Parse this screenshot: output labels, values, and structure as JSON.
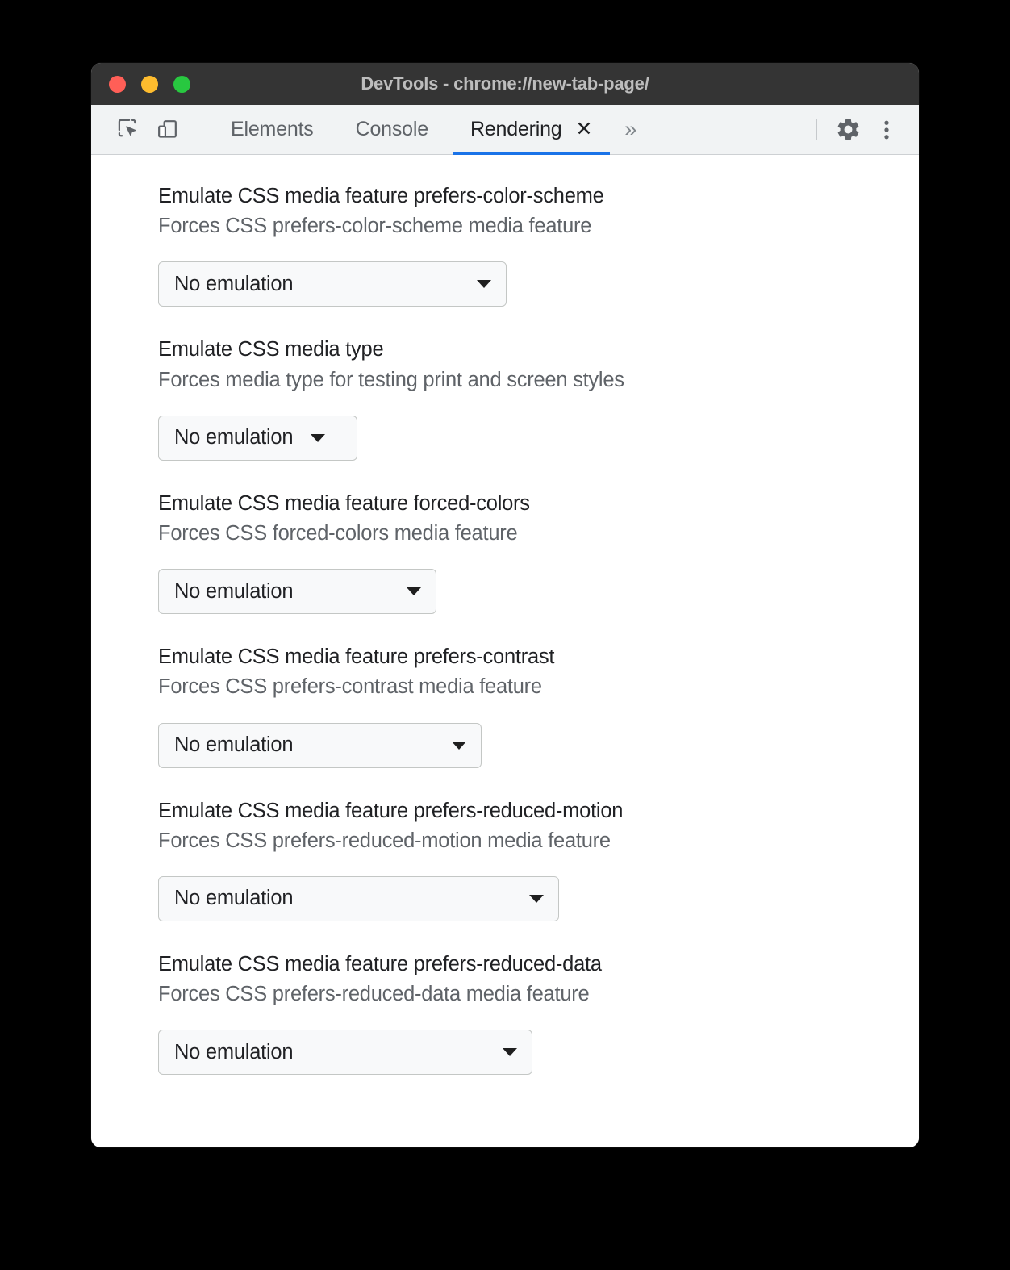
{
  "window": {
    "title": "DevTools - chrome://new-tab-page/",
    "traffic_lights": [
      {
        "name": "close",
        "color": "#FF5F57"
      },
      {
        "name": "minimize",
        "color": "#FEBC2E"
      },
      {
        "name": "maximize",
        "color": "#28C840"
      }
    ]
  },
  "toolbar": {
    "inspect_icon": "inspect-element-icon",
    "device_icon": "device-toolbar-icon",
    "tabs": [
      {
        "label": "Elements",
        "active": false,
        "closable": false
      },
      {
        "label": "Console",
        "active": false,
        "closable": false
      },
      {
        "label": "Rendering",
        "active": true,
        "closable": true,
        "close_glyph": "✕"
      }
    ],
    "more_tabs_glyph": "»",
    "settings_icon": "gear-icon",
    "overflow_icon": "kebab-menu-icon",
    "accent_color": "#1a73e8"
  },
  "panel": {
    "settings": [
      {
        "title": "Emulate CSS media feature prefers-color-scheme",
        "description": "Forces CSS prefers-color-scheme media feature",
        "select_value": "No emulation"
      },
      {
        "title": "Emulate CSS media type",
        "description": "Forces media type for testing print and screen styles",
        "select_value": "No emulation"
      },
      {
        "title": "Emulate CSS media feature forced-colors",
        "description": "Forces CSS forced-colors media feature",
        "select_value": "No emulation"
      },
      {
        "title": "Emulate CSS media feature prefers-contrast",
        "description": "Forces CSS prefers-contrast media feature",
        "select_value": "No emulation"
      },
      {
        "title": "Emulate CSS media feature prefers-reduced-motion",
        "description": "Forces CSS prefers-reduced-motion media feature",
        "select_value": "No emulation"
      },
      {
        "title": "Emulate CSS media feature prefers-reduced-data",
        "description": "Forces CSS prefers-reduced-data media feature",
        "select_value": "No emulation"
      }
    ]
  }
}
